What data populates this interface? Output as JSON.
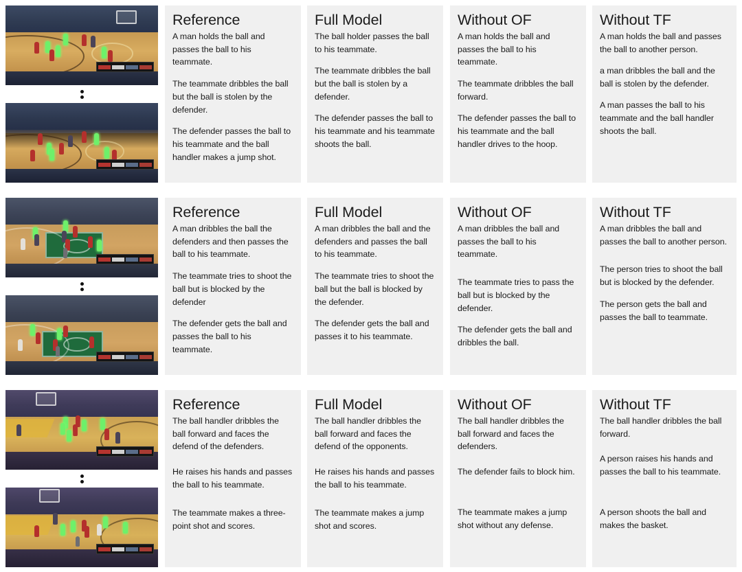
{
  "figure": {
    "columns": [
      "Reference",
      "Full Model",
      "Without OF",
      "Without TF"
    ],
    "rows": [
      {
        "id": "row-1",
        "media": {
          "frame_top_alt": "basketball-frame-top",
          "frame_bottom_alt": "basketball-frame-bottom",
          "separator": "vertical-ellipsis"
        },
        "cells": [
          {
            "title": "Reference",
            "sentences": [
              "A man holds the ball and passes the ball to his teammate.",
              "The teammate dribbles the ball but the ball is stolen by the defender.",
              "The defender passes the ball to his  teammate and the ball handler makes a jump shot."
            ]
          },
          {
            "title": "Full Model",
            "sentences": [
              "The ball holder passes the ball to his teammate.",
              "The teammate dribbles the ball but the ball is stolen by a defender.",
              "The defender passes the ball to his  teammate and his teammate shoots the ball."
            ]
          },
          {
            "title": "Without OF",
            "sentences": [
              "A man holds the ball and passes the ball to his teammate.",
              "The teammate dribbles the ball forward.",
              "The defender passes the ball to his  teammate and the ball handler drives to the hoop."
            ]
          },
          {
            "title": "Without TF",
            "sentences": [
              "A man holds the ball and passes the ball to another person.",
              "a man dribbles the ball and the ball is stolen by the defender.",
              "A man passes the ball to his  teammate and the ball handler shoots the ball."
            ]
          }
        ]
      },
      {
        "id": "row-2",
        "media": {
          "frame_top_alt": "basketball-frame-top",
          "frame_bottom_alt": "basketball-frame-bottom",
          "separator": "vertical-ellipsis"
        },
        "cells": [
          {
            "title": "Reference",
            "sentences": [
              "A man dribbles the ball  the defenders and then passes the ball to his teammate.",
              "The teammate tries to shoot the ball but is blocked by the defender",
              "The defender gets the ball and passes the ball to his teammate."
            ]
          },
          {
            "title": "Full Model",
            "sentences": [
              "A man dribbles the ball and the defenders and passes the ball to his teammate.",
              "The teammate tries to shoot the ball but the ball is blocked by the defender.",
              "The defender gets the ball and passes it  to his teammate."
            ]
          },
          {
            "title": "Without OF",
            "sentences": [
              "A man dribbles the ball and passes the ball to his teammate.",
              "The teammate tries to pass the ball but is blocked by the defender.",
              "The defender gets the ball and dribbles the ball."
            ]
          },
          {
            "title": "Without TF",
            "sentences": [
              "A man dribbles the ball and passes the ball to another person.",
              "The person tries to shoot the ball but is blocked by the defender.",
              "The person gets the ball and passes the ball to teammate."
            ]
          }
        ]
      },
      {
        "id": "row-3",
        "media": {
          "frame_top_alt": "basketball-frame-top",
          "frame_bottom_alt": "basketball-frame-bottom",
          "separator": "vertical-ellipsis"
        },
        "cells": [
          {
            "title": "Reference",
            "sentences": [
              "The ball  handler dribbles the ball forward and faces the defend of the defenders.",
              "He raises his hands and passes the ball to his teammate.",
              "The teammate makes a three-point shot and scores."
            ]
          },
          {
            "title": "Full Model",
            "sentences": [
              "The ball handler dribbles the ball forward and faces the defend of the opponents.",
              "He raises his hands and passes the ball to his teammate.",
              "The teammate makes  a jump shot and scores."
            ]
          },
          {
            "title": "Without OF",
            "sentences": [
              "The ball handler dribbles the ball forward and faces the defenders.",
              "The defender fails to block him.",
              "The teammate makes a jump shot without any defense."
            ]
          },
          {
            "title": "Without TF",
            "sentences": [
              "The ball handler dribbles the ball forward.",
              "A person raises his hands and passes the ball to his teammate.",
              "A person shoots the ball and makes the basket."
            ]
          }
        ]
      }
    ]
  },
  "colors": {
    "panel_background": "#f0f0f0",
    "page_background": "#ffffff",
    "title_text": "#1b1b1b",
    "body_text": "#191919",
    "highlight_mask": "#6ef06a"
  }
}
